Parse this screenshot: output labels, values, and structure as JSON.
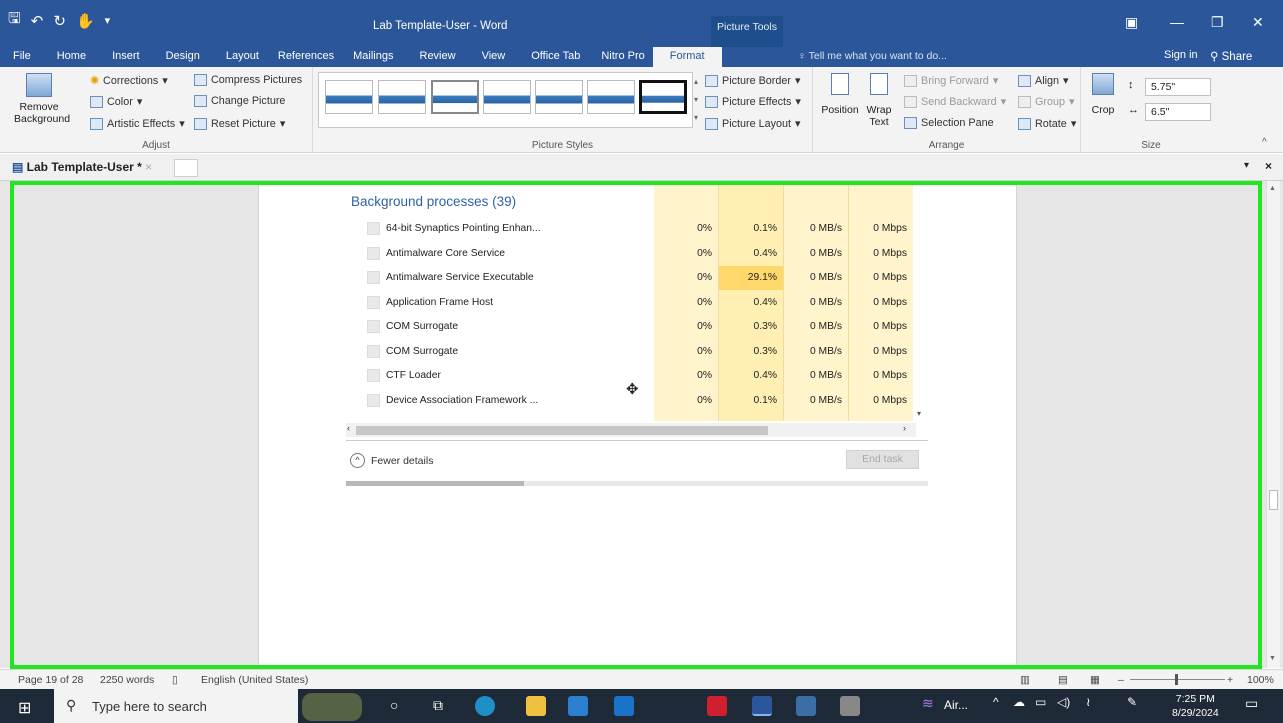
{
  "titlebar": {
    "doc_title": "Lab Template-User - Word",
    "context_tab": "Picture Tools"
  },
  "tabs": [
    "File",
    "Home",
    "Insert",
    "Design",
    "Layout",
    "References",
    "Mailings",
    "Review",
    "View",
    "Office Tab",
    "Nitro Pro",
    "Format"
  ],
  "active_tab": "Format",
  "tell_me": "Tell me what you want to do...",
  "sign_in": "Sign in",
  "share": "Share",
  "ribbon": {
    "adjust": {
      "label": "Adjust",
      "remove_bg": "Remove Background",
      "remove_bg_l1": "Remove",
      "remove_bg_l2": "Background",
      "corrections": "Corrections",
      "color": "Color",
      "artistic": "Artistic Effects",
      "compress": "Compress Pictures",
      "change": "Change Picture",
      "reset": "Reset Picture"
    },
    "styles": {
      "label": "Picture Styles",
      "border": "Picture Border",
      "effects": "Picture Effects",
      "layout": "Picture Layout"
    },
    "arrange": {
      "label": "Arrange",
      "position": "Position",
      "wrap": "Wrap",
      "wrap2": "Text",
      "bring": "Bring Forward",
      "send": "Send Backward",
      "selection": "Selection Pane",
      "align": "Align",
      "group": "Group",
      "rotate": "Rotate"
    },
    "size": {
      "label": "Size",
      "crop": "Crop",
      "height": "5.75\"",
      "width": "6.5\""
    }
  },
  "doc_tab": "Lab Template-User *",
  "taskmanager": {
    "section": "Background processes (39)",
    "rows": [
      {
        "name": "64-bit Synaptics Pointing Enhan...",
        "cpu": "0%",
        "mem": "0.1%",
        "disk": "0 MB/s",
        "net": "0 Mbps"
      },
      {
        "name": "Antimalware Core Service",
        "cpu": "0%",
        "mem": "0.4%",
        "disk": "0 MB/s",
        "net": "0 Mbps"
      },
      {
        "name": "Antimalware Service Executable",
        "cpu": "0%",
        "mem": "29.1%",
        "disk": "0 MB/s",
        "net": "0 Mbps"
      },
      {
        "name": "Application Frame Host",
        "cpu": "0%",
        "mem": "0.4%",
        "disk": "0 MB/s",
        "net": "0 Mbps"
      },
      {
        "name": "COM Surrogate",
        "cpu": "0%",
        "mem": "0.3%",
        "disk": "0 MB/s",
        "net": "0 Mbps"
      },
      {
        "name": "COM Surrogate",
        "cpu": "0%",
        "mem": "0.3%",
        "disk": "0 MB/s",
        "net": "0 Mbps"
      },
      {
        "name": "CTF Loader",
        "cpu": "0%",
        "mem": "0.4%",
        "disk": "0 MB/s",
        "net": "0 Mbps"
      },
      {
        "name": "Device Association Framework ...",
        "cpu": "0%",
        "mem": "0.1%",
        "disk": "0 MB/s",
        "net": "0 Mbps"
      }
    ],
    "fewer": "Fewer details",
    "end_task": "End task"
  },
  "status": {
    "page": "Page 19 of 28",
    "words": "2250 words",
    "lang": "English (United States)",
    "zoom": "100%"
  },
  "taskbar": {
    "search": "Type here to search",
    "tray_app": "Air...",
    "time": "7:25 PM",
    "date": "8/29/2024"
  }
}
